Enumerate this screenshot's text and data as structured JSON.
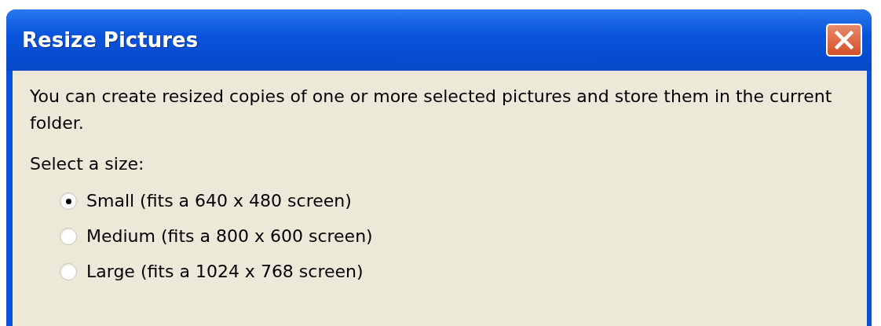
{
  "window": {
    "title": "Resize Pictures"
  },
  "intro": "You can create resized copies of one or more selected pictures and store them in the current folder.",
  "size_label": "Select a size:",
  "sizes": [
    {
      "label": "Small (fits a 640 x 480 screen)",
      "selected": true
    },
    {
      "label": "Medium (fits a 800 x 600 screen)",
      "selected": false
    },
    {
      "label": "Large (fits a 1024 x 768 screen)",
      "selected": false
    }
  ]
}
